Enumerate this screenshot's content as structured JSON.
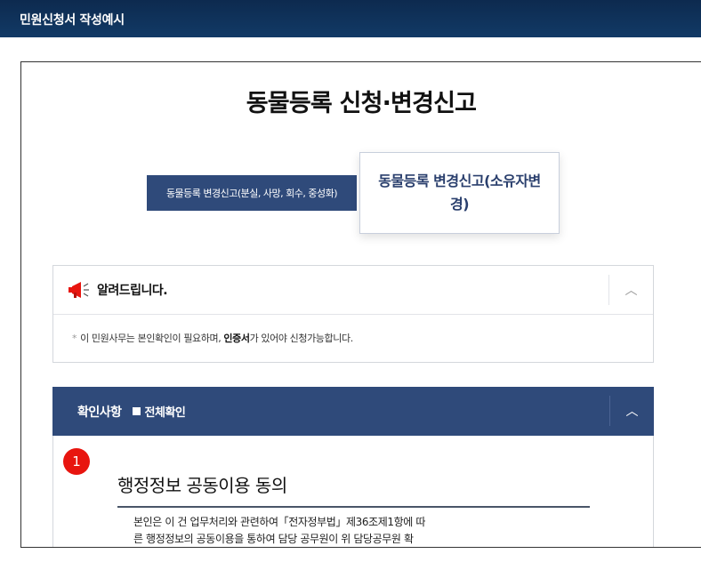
{
  "header": {
    "title": "민원신청서 작성예시"
  },
  "page": {
    "title": "동물등록 신청·변경신고"
  },
  "tabs": [
    {
      "label": "동물등록 변경신고(분실, 사망, 회수, 중성화)"
    },
    {
      "label": "동물등록 변경신고(소유자변경)"
    }
  ],
  "notice": {
    "title": "알려드립니다.",
    "toggle": "︿",
    "mark": "*",
    "text_before": "이 민원사무는 본인확인이 필요하며, ",
    "text_bold": "인증서",
    "text_after": "가 있어야 신청가능합니다."
  },
  "confirm": {
    "title": "확인사항",
    "check_all": "전체확인",
    "toggle": "︿",
    "items": [
      {
        "number": "1",
        "title": "행정정보 공동이용 동의",
        "text_line1": "본인은 이 건 업무처리와 관련하여「전자정부법」제36조제1항에 따",
        "text_line2": "른 행정정보의 공동이용을 통하여 담당 공무원이 위 담당공무원 확"
      }
    ]
  },
  "colors": {
    "topbar": "#123a66",
    "navy": "#2f4a7a",
    "badge": "#e8150f"
  }
}
